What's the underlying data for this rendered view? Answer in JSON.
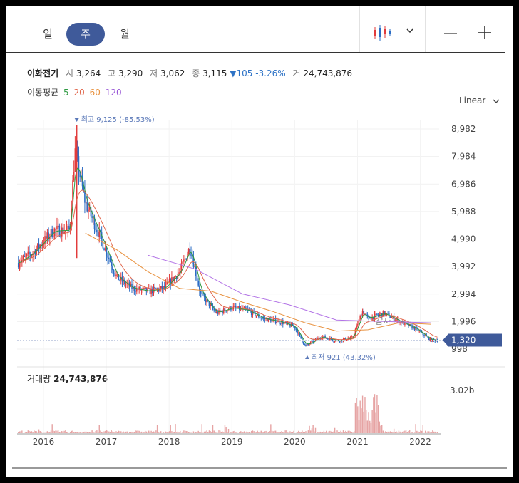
{
  "tabs": [
    {
      "label": "일"
    },
    {
      "label": "주"
    },
    {
      "label": "월"
    }
  ],
  "icons": {
    "chart_type": "candlestick-icon",
    "dropdown": "chevron-down-icon",
    "zoom_out": "minus-icon",
    "zoom_in": "plus-icon"
  },
  "stock": {
    "name": "이화전기",
    "open_label": "시",
    "open": "3,264",
    "high_label": "고",
    "high": "3,290",
    "low_label": "저",
    "low": "3,062",
    "close_label": "종",
    "close": "3,115",
    "change": "▼105 -3.26%",
    "volume_label": "거",
    "volume": "24,743,876"
  },
  "moving_average": {
    "label": "이동평균",
    "periods": [
      {
        "value": "5",
        "color": "#2f9a42"
      },
      {
        "value": "20",
        "color": "#e0654a"
      },
      {
        "value": "60",
        "color": "#e8913e"
      },
      {
        "value": "120",
        "color": "#9a5ad6"
      }
    ]
  },
  "scale": {
    "label": "Linear"
  },
  "colors": {
    "up": "#e23b3b",
    "down": "#2b6cc4",
    "badge": "#3f5a9a",
    "ma5": "#2f9a42",
    "ma20": "#e0654a",
    "ma60": "#e8913e",
    "ma120": "#b273e6"
  },
  "chart_data": {
    "type": "candlestick",
    "y_ticks": [
      "8,982",
      "7,984",
      "6,986",
      "5,988",
      "4,990",
      "3,992",
      "2,994",
      "1,996",
      "998"
    ],
    "ylim": [
      998,
      8982
    ],
    "x_ticks": [
      "2016",
      "2017",
      "2018",
      "2019",
      "2020",
      "2021",
      "2022"
    ],
    "current_price": "1,320",
    "high_annotation": "최고 9,125 (-85.53%)",
    "low_annotation": "최저 921 (43.32%)",
    "event_label": "감자",
    "series": [
      {
        "name": "price",
        "x": [
          "2015-08",
          "2015-11",
          "2016-03",
          "2016-06",
          "2016-07",
          "2016-09",
          "2016-12",
          "2017-03",
          "2017-06",
          "2017-09",
          "2017-12",
          "2018-03",
          "2018-05",
          "2018-07",
          "2018-10",
          "2019-01",
          "2019-04",
          "2019-07",
          "2019-10",
          "2020-01",
          "2020-03",
          "2020-06",
          "2020-09",
          "2020-12",
          "2021-02",
          "2021-03",
          "2021-06",
          "2021-09",
          "2021-12",
          "2022-03"
        ],
        "values": [
          4100,
          4500,
          5300,
          5300,
          8200,
          6300,
          5000,
          3600,
          3200,
          3100,
          3200,
          3800,
          4700,
          3000,
          2300,
          2500,
          2400,
          2100,
          2000,
          1800,
          1100,
          1450,
          1300,
          1400,
          2400,
          2100,
          2300,
          2000,
          1750,
          1320
        ]
      },
      {
        "name": "ma120",
        "x": [
          "2017-09",
          "2018-06",
          "2019-03",
          "2019-12",
          "2020-09",
          "2021-06",
          "2022-03"
        ],
        "values": [
          4400,
          3900,
          3000,
          2600,
          2050,
          2000,
          1950
        ]
      },
      {
        "name": "ma60",
        "x": [
          "2016-09",
          "2017-03",
          "2017-09",
          "2018-03",
          "2018-09",
          "2019-03",
          "2019-09",
          "2020-03",
          "2020-09",
          "2021-03",
          "2021-09",
          "2022-03"
        ],
        "values": [
          5200,
          4600,
          3800,
          3200,
          3100,
          2700,
          2350,
          1950,
          1650,
          1700,
          1950,
          1900
        ]
      }
    ],
    "volume": {
      "title": "거래량",
      "value": "24,743,876",
      "y_tick": "3.02b"
    }
  }
}
